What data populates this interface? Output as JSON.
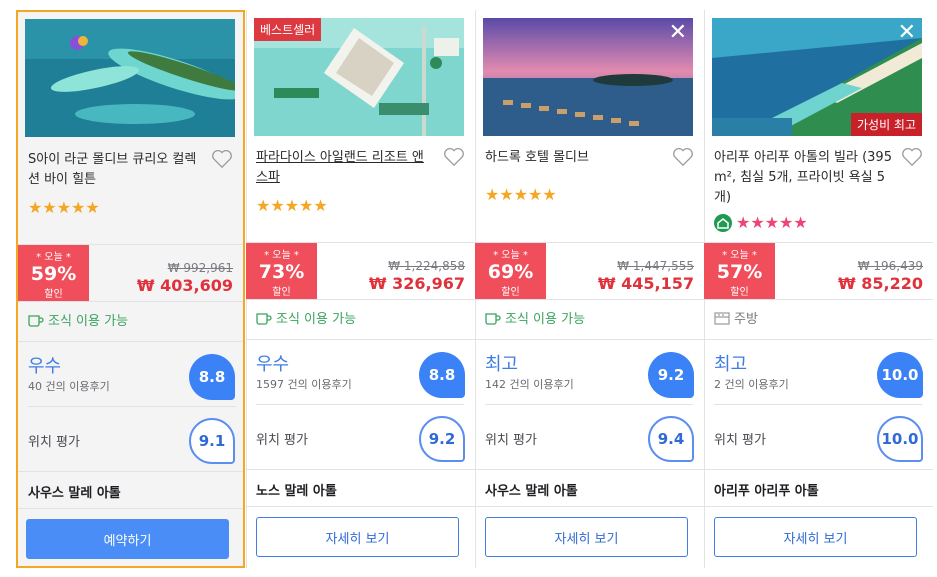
{
  "colors": {
    "primary": "#4a8df6",
    "selected_border": "#f5a623",
    "deal_red": "#f04e5b",
    "price_red": "#e0323c",
    "star_gold": "#f5a623",
    "star_pink": "#ec4676",
    "amenity_green": "#3aa55d"
  },
  "cards": [
    {
      "name": "S아이 라군 몰디브 큐리오 컬렉션 바이 힐튼",
      "ribbon": "",
      "ribbon_br": "",
      "stars": "★★★★★",
      "star_count": 5,
      "deal_today": "* 오늘 *",
      "deal_pct": "59%",
      "deal_label": "할인",
      "old_price": "₩ 992,961",
      "new_price": "₩ 403,609",
      "amenity": "조식 이용 가능",
      "amenity_icon": "coffee-cup-icon",
      "rating_word": "우수",
      "reviews": "40 건의 이용후기",
      "score": "8.8",
      "location_label": "위치 평가",
      "location_score": "9.1",
      "area": "사우스 말레 아톨",
      "button": "예약하기"
    },
    {
      "name": "파라다이스 아일랜드 리조트 앤 스파",
      "ribbon": "베스트셀러",
      "ribbon_br": "",
      "stars": "★★★★★",
      "star_count": 5,
      "deal_today": "* 오늘 *",
      "deal_pct": "73%",
      "deal_label": "할인",
      "old_price": "₩ 1,224,858",
      "new_price": "₩ 326,967",
      "amenity": "조식 이용 가능",
      "amenity_icon": "coffee-cup-icon",
      "rating_word": "우수",
      "reviews": "1597 건의 이용후기",
      "score": "8.8",
      "location_label": "위치 평가",
      "location_score": "9.2",
      "area": "노스 말레 아톨",
      "button": "자세히 보기"
    },
    {
      "name": "하드록 호텔 몰디브",
      "ribbon": "",
      "ribbon_br": "",
      "stars": "★★★★★",
      "star_count": 5,
      "deal_today": "* 오늘 *",
      "deal_pct": "69%",
      "deal_label": "할인",
      "old_price": "₩ 1,447,555",
      "new_price": "₩ 445,157",
      "amenity": "조식 이용 가능",
      "amenity_icon": "coffee-cup-icon",
      "rating_word": "최고",
      "reviews": "142 건의 이용후기",
      "score": "9.2",
      "location_label": "위치 평가",
      "location_score": "9.4",
      "area": "사우스 말레 아톨",
      "button": "자세히 보기"
    },
    {
      "name": "아리푸 아리푸 아톨의 빌라 (395 m², 침실 5개, 프라이빗 욕실 5개)",
      "ribbon": "",
      "ribbon_br": "가성비 최고",
      "stars": "★★★★★",
      "star_count": 5,
      "deal_today": "* 오늘 *",
      "deal_pct": "57%",
      "deal_label": "할인",
      "old_price": "₩ 196,439",
      "new_price": "₩ 85,220",
      "amenity": "주방",
      "amenity_icon": "kitchen-icon",
      "rating_word": "최고",
      "reviews": "2 건의 이용후기",
      "score": "10.0",
      "location_label": "위치 평가",
      "location_score": "10.0",
      "area": "아리푸 아리푸 아톨",
      "button": "자세히 보기"
    }
  ]
}
